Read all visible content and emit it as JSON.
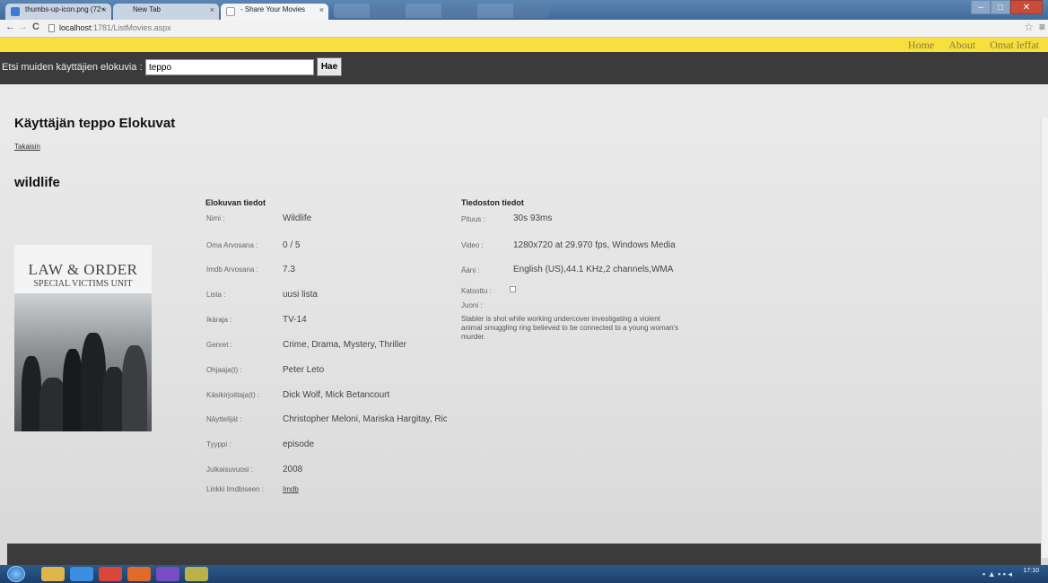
{
  "browser": {
    "tabs": [
      {
        "label": "thumbs-up-icon.png (72×",
        "active": false
      },
      {
        "label": "New Tab",
        "active": false
      },
      {
        "label": "- Share Your Movies",
        "active": true
      }
    ],
    "url_host": "localhost",
    "url_path": ":1781/ListMovies.aspx"
  },
  "nav": {
    "home": "Home",
    "about": "About",
    "my_movies": "Omat leffat"
  },
  "search": {
    "label": "Etsi muiden käyttäjien elokuvia :",
    "value": "teppo",
    "button": "Hae"
  },
  "page": {
    "user_title": "Käyttäjän teppo Elokuvat",
    "back_link": "Takaisin",
    "movie_title": "wildlife"
  },
  "poster": {
    "brand": "LAW & ORDER",
    "subtitle": "SPECIAL VICTIMS UNIT"
  },
  "movie_info": {
    "heading": "Elokuvan tiedot",
    "rows": [
      {
        "label": "Nimi :",
        "value": "Wildlife"
      },
      {
        "label": "Oma Arvosana :",
        "value": "0 / 5"
      },
      {
        "label": "Imdb Arvosana :",
        "value": "7.3"
      },
      {
        "label": "Lista :",
        "value": "uusi lista"
      },
      {
        "label": "Ikäraja :",
        "value": "TV-14"
      },
      {
        "label": "Genret :",
        "value": "Crime, Drama, Mystery, Thriller"
      },
      {
        "label": "Ohjaaja(t) :",
        "value": "Peter Leto"
      },
      {
        "label": "Käsikirjoittaja(t) :",
        "value": "Dick Wolf, Mick Betancourt"
      },
      {
        "label": "Näyttelijät :",
        "value": "Christopher Meloni, Mariska Hargitay, Richard Belzer"
      },
      {
        "label": "Tyyppi :",
        "value": "episode"
      },
      {
        "label": "Julkaisuvuosi :",
        "value": "2008"
      },
      {
        "label": "Linkki Imdbiseen :",
        "value": "Imdb"
      }
    ]
  },
  "file_info": {
    "heading": "Tiedoston tiedot",
    "rows": [
      {
        "label": "Pituus :",
        "value": "30s 93ms"
      },
      {
        "label": "Video :",
        "value": "1280x720 at 29.970 fps, Windows Media"
      },
      {
        "label": "Ääni :",
        "value": "English (US),44.1 KHz,2 channels,WMA"
      }
    ],
    "watched_label": "Katsottu :",
    "plot_label": "Juoni :",
    "plot": "Stabler is shot while working undercover investigating a violent animal smuggling ring believed to be connected to a young woman's murder."
  },
  "taskbar": {
    "clock": "17:10"
  },
  "colors": {
    "yellow_bar": "#f7df3d",
    "dark_bar": "#3b3b3b",
    "nav_text": "#8a7d42"
  }
}
